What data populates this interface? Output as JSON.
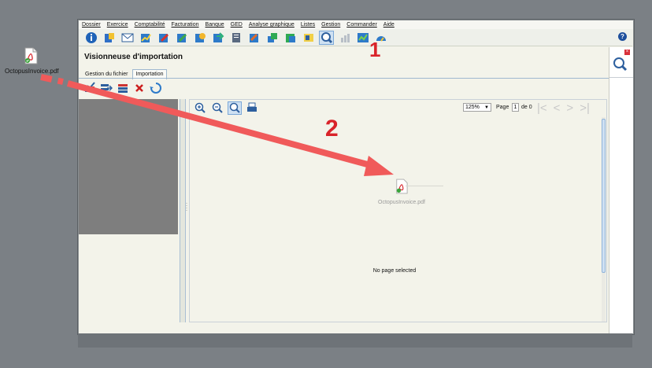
{
  "desktop": {
    "file_label": "OctopusInvoice.pdf",
    "icon": "pdf-file-icon"
  },
  "menubar": {
    "items": [
      "Dossier",
      "Exercice",
      "Comptabilité",
      "Facturation",
      "Banque",
      "GED",
      "Analyse graphique",
      "Listes",
      "Gestion",
      "Commander",
      "Aide"
    ]
  },
  "window": {
    "title": "Visionneuse d'importation",
    "tabs": [
      "Gestion du fichier",
      "Importation"
    ],
    "selected_tab": "Importation"
  },
  "viewer": {
    "zoom": "125%",
    "page_label": "Page",
    "page_value": "1",
    "of_label": "de 0",
    "empty_message": "No page selected",
    "dropped_file_label": "OctopusInvoice.pdf"
  },
  "annotations": {
    "step1": "1",
    "step2": "2",
    "color": "#d9232a"
  }
}
